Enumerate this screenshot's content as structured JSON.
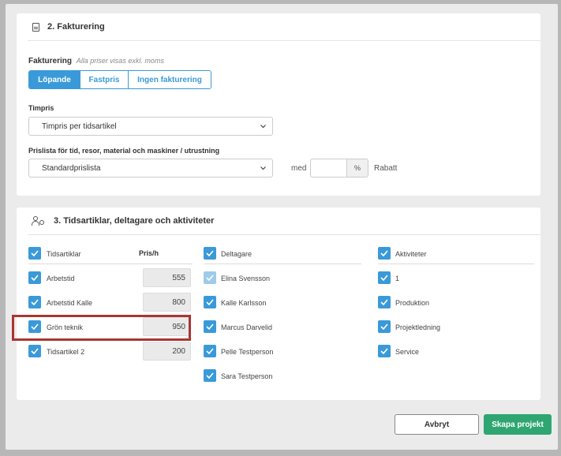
{
  "section2": {
    "title": "2. Fakturering",
    "billing_label": "Fakturering",
    "billing_note": "Alla priser visas exkl. moms",
    "billing_options": [
      "Löpande",
      "Fastpris",
      "Ingen fakturering"
    ],
    "billing_selected": "Löpande",
    "hourly_label": "Timpris",
    "hourly_value": "Timpris per tidsartikel",
    "pricelist_label": "Prislista för tid, resor, material och maskiner / utrustning",
    "pricelist_value": "Standardprislista",
    "with_text": "med",
    "discount_value": "",
    "percent_unit": "%",
    "discount_label": "Rabatt"
  },
  "section3": {
    "title": "3. Tidsartiklar, deltagare och aktiviteter",
    "time_articles": {
      "header": "Tidsartiklar",
      "price_header": "Pris/h",
      "rows": [
        {
          "label": "Arbetstid",
          "price": "555",
          "checked": true
        },
        {
          "label": "Arbetstid Kalle",
          "price": "800",
          "checked": true
        },
        {
          "label": "Grön teknik",
          "price": "950",
          "checked": true
        },
        {
          "label": "Tidsartikel 2",
          "price": "200",
          "checked": true
        }
      ]
    },
    "participants": {
      "header": "Deltagare",
      "rows": [
        {
          "label": "Elina Svensson",
          "checked": true,
          "disabled": true
        },
        {
          "label": "Kalle Karlsson",
          "checked": true
        },
        {
          "label": "Marcus Darvelid",
          "checked": true
        },
        {
          "label": "Pelle Testperson",
          "checked": true
        },
        {
          "label": "Sara Testperson",
          "checked": true
        }
      ]
    },
    "activities": {
      "header": "Aktiviteter",
      "rows": [
        {
          "label": "1",
          "checked": true
        },
        {
          "label": "Produktion",
          "checked": true
        },
        {
          "label": "Projektledning",
          "checked": true
        },
        {
          "label": "Service",
          "checked": true
        }
      ]
    }
  },
  "footer": {
    "cancel_label": "Avbryt",
    "create_label": "Skapa projekt"
  },
  "colors": {
    "accent": "#3a9ad9",
    "create": "#2fa671",
    "highlight": "#a93532"
  }
}
